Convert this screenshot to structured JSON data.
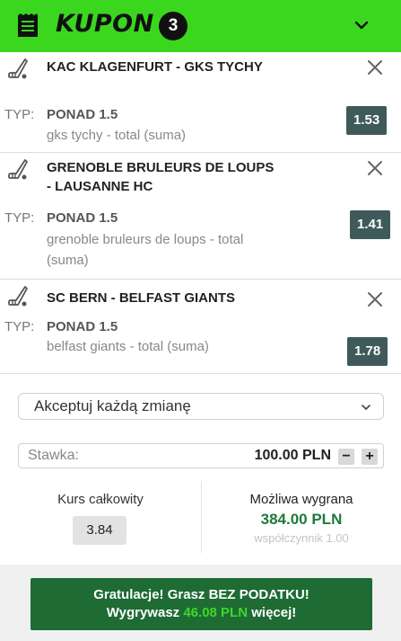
{
  "header": {
    "title": "KUPON",
    "count": "3",
    "bg_color": "#3ad71e"
  },
  "bets": [
    {
      "match": "KAC KLAGENFURT - GKS TYCHY",
      "type_label": "TYP:",
      "pick": "PONAD 1.5",
      "desc": "gks tychy - total (suma)",
      "odd": "1.53",
      "icon": "hockey-stick-icon"
    },
    {
      "match": "GRENOBLE BRULEURS DE LOUPS - LAUSANNE HC",
      "type_label": "TYP:",
      "pick": "PONAD 1.5",
      "desc": "grenoble bruleurs de loups - total (suma)",
      "odd": "1.41",
      "icon": "hockey-stick-icon"
    },
    {
      "match": "SC BERN - BELFAST GIANTS",
      "type_label": "TYP:",
      "pick": "PONAD 1.5",
      "desc": "belfast giants - total (suma)",
      "odd": "1.78",
      "icon": "hockey-stick-icon"
    }
  ],
  "accept_select": {
    "value": "Akceptuj każdą zmianę"
  },
  "stake": {
    "label": "Stawka:",
    "amount": "100.00 PLN",
    "minus": "−",
    "plus": "+"
  },
  "summary": {
    "kurs_label": "Kurs całkowity",
    "kurs_value": "3.84",
    "win_label": "Możliwa wygrana",
    "win_value": "384.00 PLN",
    "coef": "współczynnik 1.00"
  },
  "footer": {
    "line1": "Gratulacje! Grasz BEZ PODATKU!",
    "line2_prefix": "Wygrywasz",
    "line2_amount": "46.08 PLN",
    "line2_suffix": "więcej!"
  },
  "colors": {
    "accent_green": "#3ad71e",
    "odd_bg": "#3f5a5a",
    "win_green": "#1e7a3a",
    "cta_bg": "#1e6b34"
  }
}
